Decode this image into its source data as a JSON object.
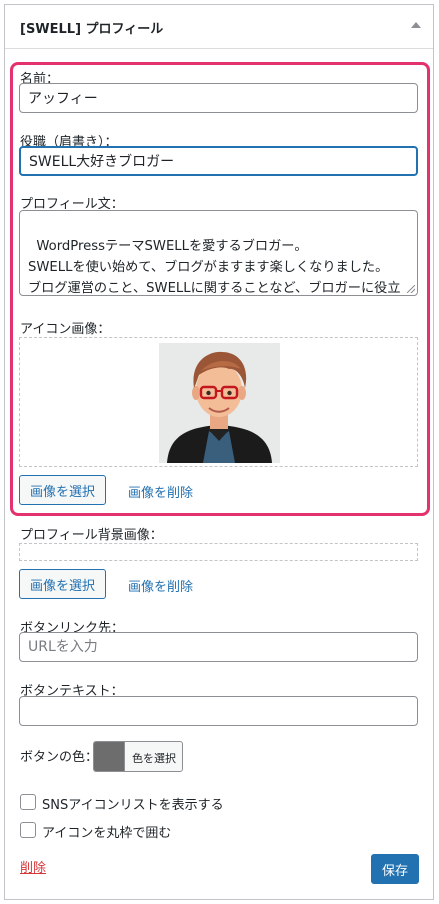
{
  "widget": {
    "title": "[SWELL] プロフィール"
  },
  "form": {
    "name_label": "名前：",
    "name_value": "アッフィー",
    "position_label": "役職（肩書き）：",
    "position_value": "SWELL大好きブロガー",
    "profile_text_label": "プロフィール文：",
    "profile_text_value": "WordPressテーマSWELLを愛するブロガー。\nSWELLを使い始めて、ブログがますます楽しくなりました。\nブログ運営のこと、SWELLに関することなど、ブロガーに役立つ情報を発信しています。",
    "icon_image_label": "アイコン画像：",
    "icon_select_button": "画像を選択",
    "icon_delete_link": "画像を削除",
    "bg_image_label": "プロフィール背景画像：",
    "bg_select_button": "画像を選択",
    "bg_delete_link": "画像を削除",
    "button_link_label": "ボタンリンク先：",
    "button_link_placeholder": "URLを入力",
    "button_text_label": "ボタンテキスト：",
    "button_text_value": "",
    "button_color_label": "ボタンの色：",
    "color_select_label": "色を選択",
    "button_color_value": "#6d6d6d",
    "sns_checkbox_label": "SNSアイコンリストを表示する",
    "sns_checked": false,
    "circle_checkbox_label": "アイコンを丸枠で囲む",
    "circle_checked": false
  },
  "footer": {
    "delete_label": "削除",
    "save_label": "保存"
  },
  "colors": {
    "accent": "#2271b1",
    "highlight_border": "#e4326e",
    "delete": "#d63638"
  }
}
